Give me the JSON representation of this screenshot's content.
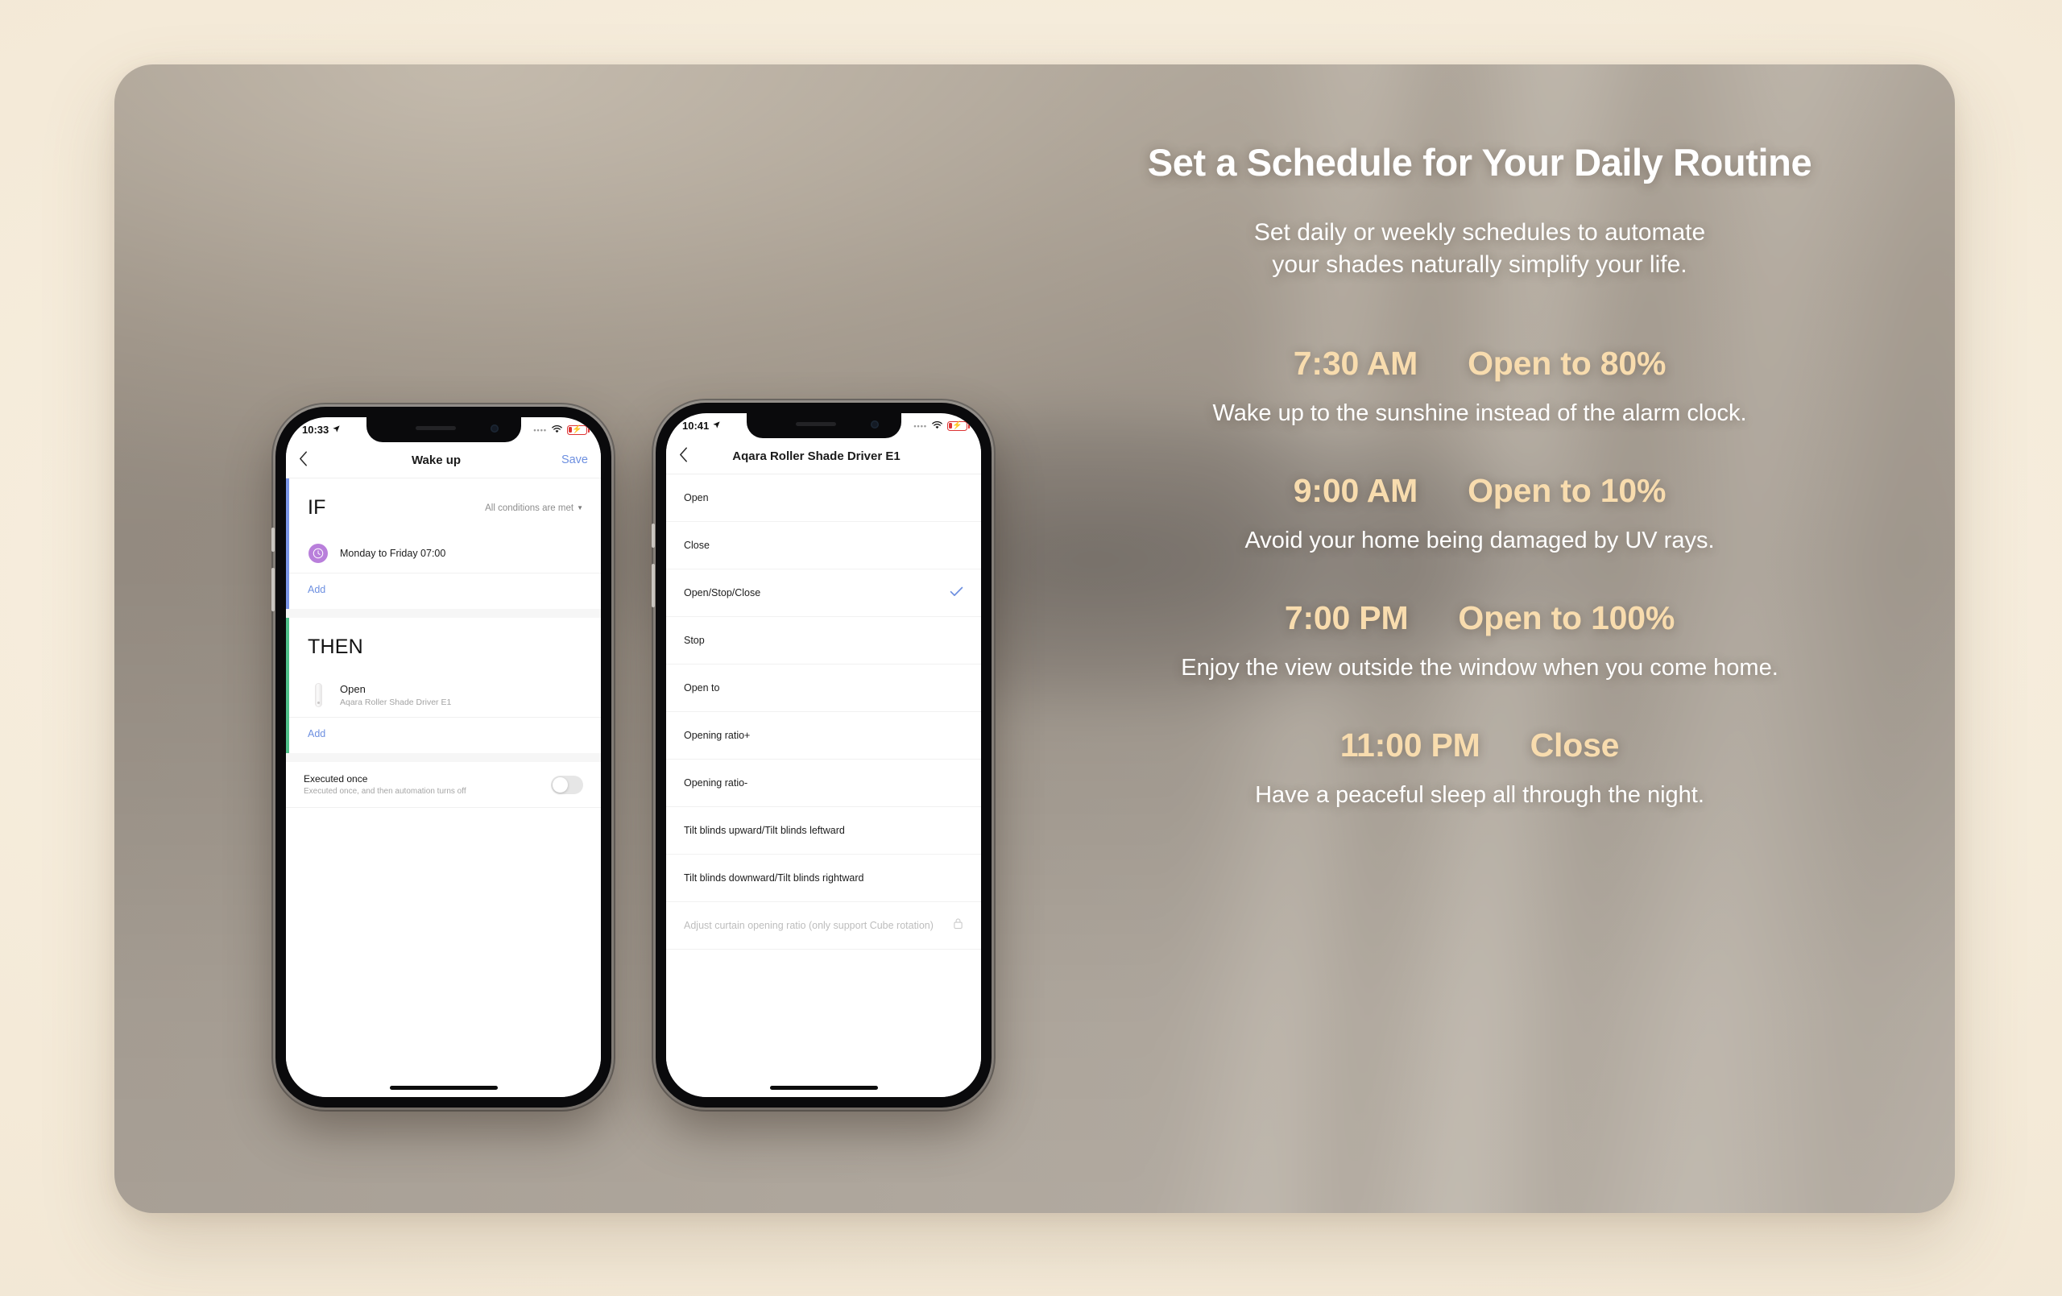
{
  "hero": {
    "headline": "Set a Schedule for Your Daily Routine",
    "subhead_line1": "Set daily or weekly schedules to automate",
    "subhead_line2": "your shades naturally simplify your life.",
    "accent_color": "#f8dcae",
    "text_color": "#ffffff",
    "background_color": "#f7eede"
  },
  "schedule": [
    {
      "time": "7:30 AM",
      "action": "Open to 80%",
      "description": "Wake up to the sunshine instead of the alarm clock."
    },
    {
      "time": "9:00 AM",
      "action": "Open to 10%",
      "description": "Avoid your home being damaged by UV rays."
    },
    {
      "time": "7:00 PM",
      "action": "Open to 100%",
      "description": "Enjoy the view outside the window when you come home."
    },
    {
      "time": "11:00 PM",
      "action": "Close",
      "description": "Have a peaceful sleep all through the night."
    }
  ],
  "phone1": {
    "status": {
      "time": "10:33",
      "location_icon": "location-arrow-icon",
      "signal_icon": "signal-dots-icon",
      "wifi_icon": "wifi-icon",
      "battery_icon": "battery-charging-icon"
    },
    "nav": {
      "back_icon": "chevron-left-icon",
      "title": "Wake up",
      "action": "Save"
    },
    "if_section": {
      "title": "IF",
      "condition_mode": "All conditions are met",
      "caret_icon": "caret-down-icon",
      "trigger": {
        "icon": "clock-icon",
        "label": "Monday to Friday 07:00"
      },
      "add_label": "Add"
    },
    "then_section": {
      "title": "THEN",
      "action": {
        "icon": "roller-shade-icon",
        "title": "Open",
        "device": "Aqara Roller Shade Driver E1"
      },
      "add_label": "Add"
    },
    "executed_once": {
      "title": "Executed once",
      "subtitle": "Executed once, and then automation turns off",
      "toggle_state": "off"
    }
  },
  "phone2": {
    "status": {
      "time": "10:41",
      "location_icon": "location-arrow-icon",
      "signal_icon": "signal-dots-icon",
      "wifi_icon": "wifi-icon",
      "battery_icon": "battery-charging-icon"
    },
    "nav": {
      "back_icon": "chevron-left-icon",
      "title": "Aqara Roller Shade Driver E1"
    },
    "actions": [
      {
        "label": "Open",
        "selected": false,
        "locked": false
      },
      {
        "label": "Close",
        "selected": false,
        "locked": false
      },
      {
        "label": "Open/Stop/Close",
        "selected": true,
        "locked": false
      },
      {
        "label": "Stop",
        "selected": false,
        "locked": false
      },
      {
        "label": "Open to",
        "selected": false,
        "locked": false
      },
      {
        "label": "Opening ratio+",
        "selected": false,
        "locked": false
      },
      {
        "label": "Opening ratio-",
        "selected": false,
        "locked": false
      },
      {
        "label": "Tilt blinds upward/Tilt blinds leftward",
        "selected": false,
        "locked": false
      },
      {
        "label": "Tilt blinds downward/Tilt blinds rightward",
        "selected": false,
        "locked": false
      },
      {
        "label": "Adjust curtain opening ratio (only support Cube rotation)",
        "selected": false,
        "locked": true
      }
    ]
  }
}
